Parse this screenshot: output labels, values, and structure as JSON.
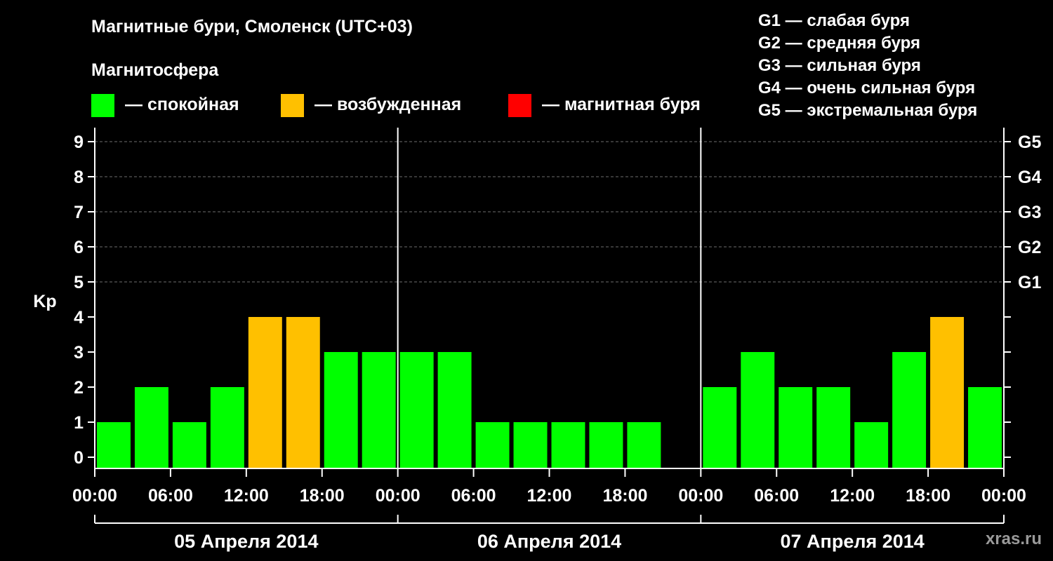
{
  "title": "Магнитные бури, Смоленск (UTC+03)",
  "subtitle": "Магнитосфера",
  "colors": {
    "quiet": "#00ff00",
    "excited": "#ffc000",
    "storm": "#ff0000",
    "background": "#000000",
    "credit": "#9a9a9a"
  },
  "legend": [
    {
      "color_key": "quiet",
      "label": "— спокойная"
    },
    {
      "color_key": "excited",
      "label": "— возбужденная"
    },
    {
      "color_key": "storm",
      "label": "— магнитная буря"
    }
  ],
  "g_scale": [
    "G1 — слабая буря",
    "G2 — средняя буря",
    "G3 — сильная буря",
    "G4 — очень сильная буря",
    "G5 — экстремальная буря"
  ],
  "credit": "xras.ru",
  "chart_data": {
    "type": "bar",
    "ylabel": "Kp",
    "ylim": [
      0,
      9
    ],
    "yticks": [
      0,
      1,
      2,
      3,
      4,
      5,
      6,
      7,
      8,
      9
    ],
    "right_axis_labels": [
      {
        "y": 5,
        "label": "G1"
      },
      {
        "y": 6,
        "label": "G2"
      },
      {
        "y": 7,
        "label": "G3"
      },
      {
        "y": 8,
        "label": "G4"
      },
      {
        "y": 9,
        "label": "G5"
      }
    ],
    "grid": "horizontal dashed",
    "xticks": [
      "00:00",
      "06:00",
      "12:00",
      "18:00",
      "00:00",
      "06:00",
      "12:00",
      "18:00",
      "00:00",
      "06:00",
      "12:00",
      "18:00",
      "00:00"
    ],
    "days": [
      "05 Апреля 2014",
      "06 Апреля 2014",
      "07 Апреля 2014"
    ],
    "interval_hours": 3,
    "categories": [
      "05 00-03",
      "05 03-06",
      "05 06-09",
      "05 09-12",
      "05 12-15",
      "05 15-18",
      "05 18-21",
      "05 21-24",
      "06 00-03",
      "06 03-06",
      "06 06-09",
      "06 09-12",
      "06 12-15",
      "06 15-18",
      "06 18-21",
      "06 21-24",
      "07 00-03",
      "07 03-06",
      "07 06-09",
      "07 09-12",
      "07 12-15",
      "07 15-18",
      "07 18-21",
      "07 21-24"
    ],
    "values": [
      1,
      2,
      1,
      2,
      4,
      4,
      3,
      3,
      3,
      3,
      1,
      1,
      1,
      1,
      1,
      null,
      2,
      3,
      2,
      2,
      1,
      3,
      4,
      2
    ],
    "bar_colors": [
      "quiet",
      "quiet",
      "quiet",
      "quiet",
      "excited",
      "excited",
      "quiet",
      "quiet",
      "quiet",
      "quiet",
      "quiet",
      "quiet",
      "quiet",
      "quiet",
      "quiet",
      null,
      "quiet",
      "quiet",
      "quiet",
      "quiet",
      "quiet",
      "quiet",
      "excited",
      "quiet"
    ]
  }
}
